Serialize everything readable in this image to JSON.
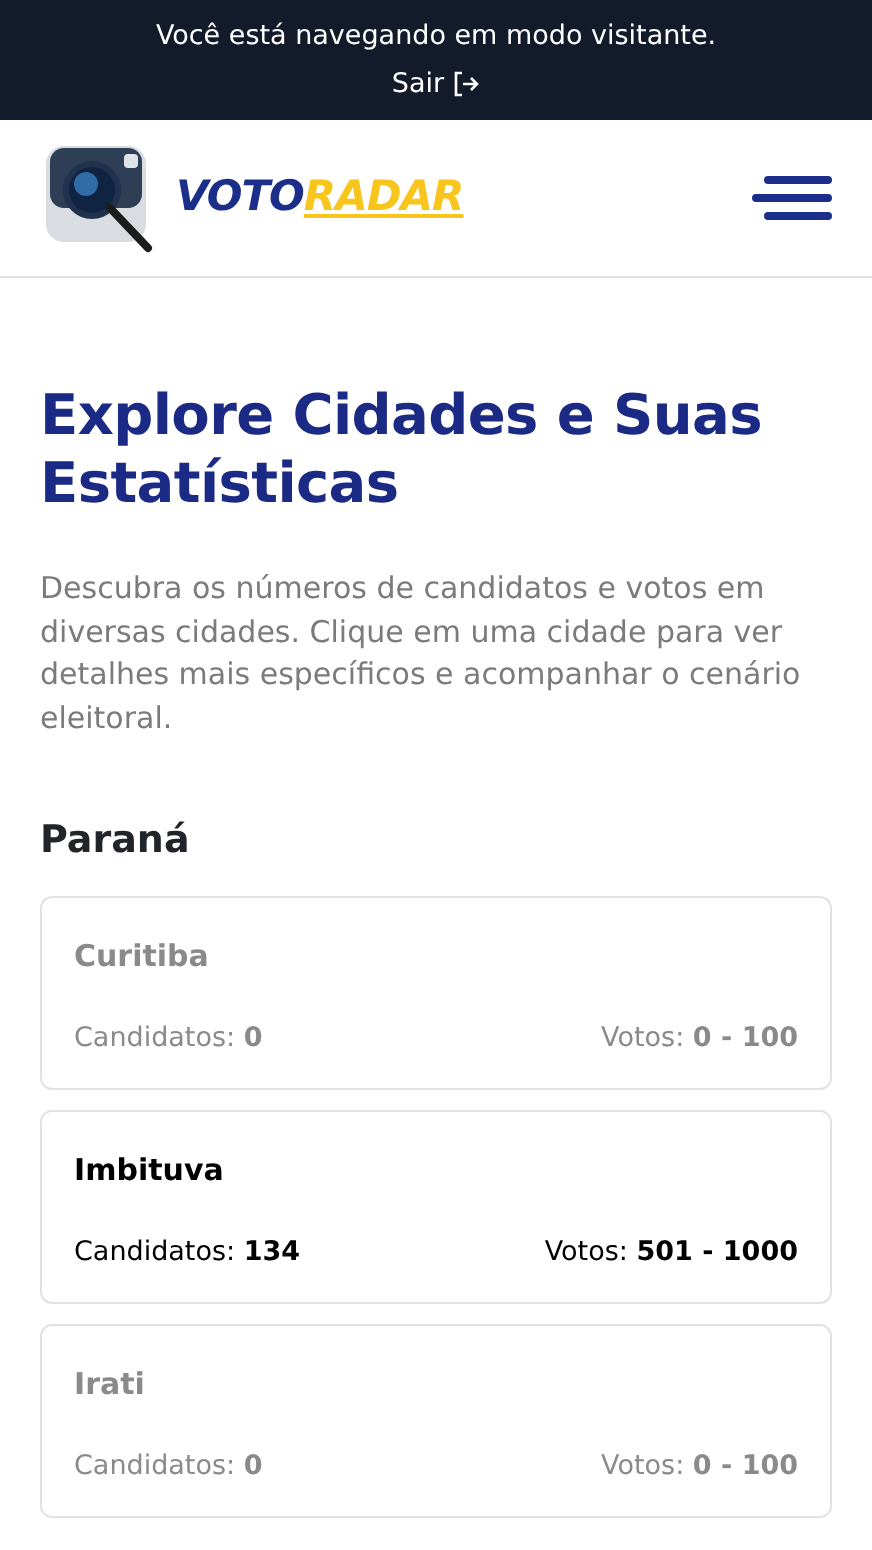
{
  "banner": {
    "message": "Você está navegando em modo visitante.",
    "exit_link": "Sair"
  },
  "header": {
    "logo_part_1": "VOTO",
    "logo_part_2": "RADAR"
  },
  "title": "Explore Cidades e Suas Estatísticas",
  "description": "Descubra os números de candidatos e votos em diversas cidades. Clique em uma cidade para ver detalhes mais específicos e acompanhar o cenário eleitoral.",
  "state": "Paraná",
  "cities": [
    {
      "name": "Curitiba",
      "disabled": true,
      "candidates": "Candidatos: **0**",
      "votes": "Votos: **0 - 100**"
    },
    {
      "name": "Imbituva",
      "disabled": false,
      "candidates": "Candidatos: **134**",
      "votes": "Votos: **501 - 1000**"
    },
    {
      "name": "Irati",
      "disabled": true,
      "candidates": "Candidatos: **0**",
      "votes": "Votos: **0 - 100**"
    }
  ]
}
